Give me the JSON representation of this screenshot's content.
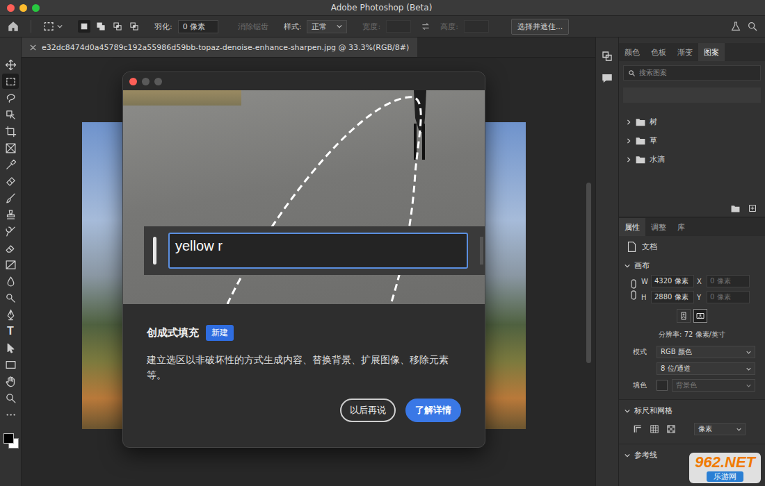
{
  "window": {
    "title": "Adobe Photoshop (Beta)"
  },
  "options_bar": {
    "selection_modes": [
      {
        "kind": "new",
        "selected": true
      },
      {
        "kind": "add",
        "selected": false
      },
      {
        "kind": "subtract",
        "selected": false
      },
      {
        "kind": "intersect",
        "selected": false
      }
    ],
    "feather": {
      "label": "羽化:",
      "value": "0 像素"
    },
    "antialias": {
      "label": "消除锯齿",
      "disabled": true
    },
    "style": {
      "label": "样式:",
      "value": "正常"
    },
    "width": {
      "label": "宽度:",
      "disabled": true
    },
    "height": {
      "label": "高度:",
      "disabled": true
    },
    "select_and_mask": "选择并遮住..."
  },
  "document_tab": {
    "title": "e32dc8474d0a45789c192a55986d59bb-topaz-denoise-enhance-sharpen.jpg @ 33.3%(RGB/8#)"
  },
  "tools": [
    {
      "kind": "move",
      "selected": false
    },
    {
      "kind": "marquee",
      "selected": true
    },
    {
      "kind": "lasso",
      "selected": false
    },
    {
      "kind": "object",
      "selected": false
    },
    {
      "kind": "crop",
      "selected": false
    },
    {
      "kind": "frame",
      "selected": false
    },
    {
      "kind": "eyedropper",
      "selected": false
    },
    {
      "kind": "healing",
      "selected": false
    },
    {
      "kind": "brush",
      "selected": false
    },
    {
      "kind": "stamp",
      "selected": false
    },
    {
      "kind": "history",
      "selected": false
    },
    {
      "kind": "eraser",
      "selected": false
    },
    {
      "kind": "gradient",
      "selected": false
    },
    {
      "kind": "blur",
      "selected": false
    },
    {
      "kind": "dodge",
      "selected": false
    },
    {
      "kind": "pen",
      "selected": false
    },
    {
      "kind": "type",
      "glyph": "T",
      "selected": false
    },
    {
      "kind": "path",
      "selected": false
    },
    {
      "kind": "rectangle",
      "selected": false
    },
    {
      "kind": "hand",
      "selected": false
    },
    {
      "kind": "zoom",
      "selected": false
    },
    {
      "kind": "more",
      "selected": false
    }
  ],
  "dialog": {
    "prompt": "yellow r",
    "title": "创成式填充",
    "badge": "新建",
    "description": "建立选区以非破坏性的方式生成内容、替换背景、扩展图像、移除元素等。",
    "buttons": [
      {
        "label": "以后再说",
        "primary": false
      },
      {
        "label": "了解详情",
        "primary": true
      }
    ]
  },
  "library_panel": {
    "tabs": [
      {
        "label": "颜色",
        "selected": false
      },
      {
        "label": "色板",
        "selected": false
      },
      {
        "label": "渐变",
        "selected": false
      },
      {
        "label": "图案",
        "selected": true
      }
    ],
    "search_placeholder": "搜索图案",
    "groups": [
      {
        "name": "树",
        "expanded": false
      },
      {
        "name": "草",
        "expanded": false
      },
      {
        "name": "水滴",
        "expanded": false
      }
    ]
  },
  "properties_panel": {
    "tabs": [
      {
        "label": "属性",
        "selected": true
      },
      {
        "label": "调整",
        "selected": false
      },
      {
        "label": "库",
        "selected": false
      }
    ],
    "document": "文档",
    "canvas": {
      "title": "画布",
      "expanded": true,
      "width": {
        "label": "W",
        "value": "4320 像素"
      },
      "x": {
        "label": "X",
        "placeholder": "0 像素"
      },
      "height": {
        "label": "H",
        "value": "2880 像素"
      },
      "y": {
        "label": "Y",
        "placeholder": "0 像素"
      },
      "orientation": [
        {
          "kind": "portrait",
          "selected": false
        },
        {
          "kind": "landscape",
          "selected": true
        }
      ],
      "resolution": "分辨率: 72 像素/英寸",
      "mode": {
        "label": "模式",
        "value": "RGB 颜色"
      },
      "depth": "8 位/通道",
      "fill": {
        "label": "填色",
        "value": "背景色",
        "disabled": true
      }
    },
    "rulers": {
      "title": "标尺和网格",
      "expanded": true,
      "unit": "像素"
    },
    "guides": {
      "title": "参考线",
      "expanded": true
    }
  },
  "watermark": {
    "brand": "962.NET",
    "subtitle": "乐游网"
  }
}
